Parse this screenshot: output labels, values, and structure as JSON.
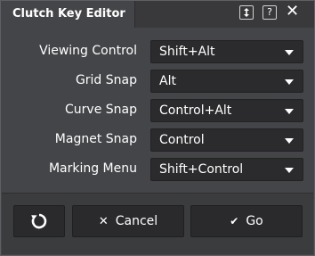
{
  "window": {
    "title": "Clutch Key Editor",
    "icons": [
      "resize-vertical-icon",
      "help-icon",
      "close-icon"
    ],
    "help_glyph": "?",
    "close_glyph": "✕"
  },
  "rows": [
    {
      "label": "Viewing Control",
      "value": "Shift+Alt"
    },
    {
      "label": "Grid Snap",
      "value": "Alt"
    },
    {
      "label": "Curve Snap",
      "value": "Control+Alt"
    },
    {
      "label": "Magnet Snap",
      "value": "Control"
    },
    {
      "label": "Marking Menu",
      "value": "Shift+Control"
    }
  ],
  "footer": {
    "reset_icon": "reset-icon",
    "cancel_label": "Cancel",
    "cancel_glyph": "✕",
    "go_label": "Go",
    "go_glyph": "✔"
  },
  "colors": {
    "background": "#444548",
    "field": "#2b2b2d",
    "text": "#ffffff"
  }
}
